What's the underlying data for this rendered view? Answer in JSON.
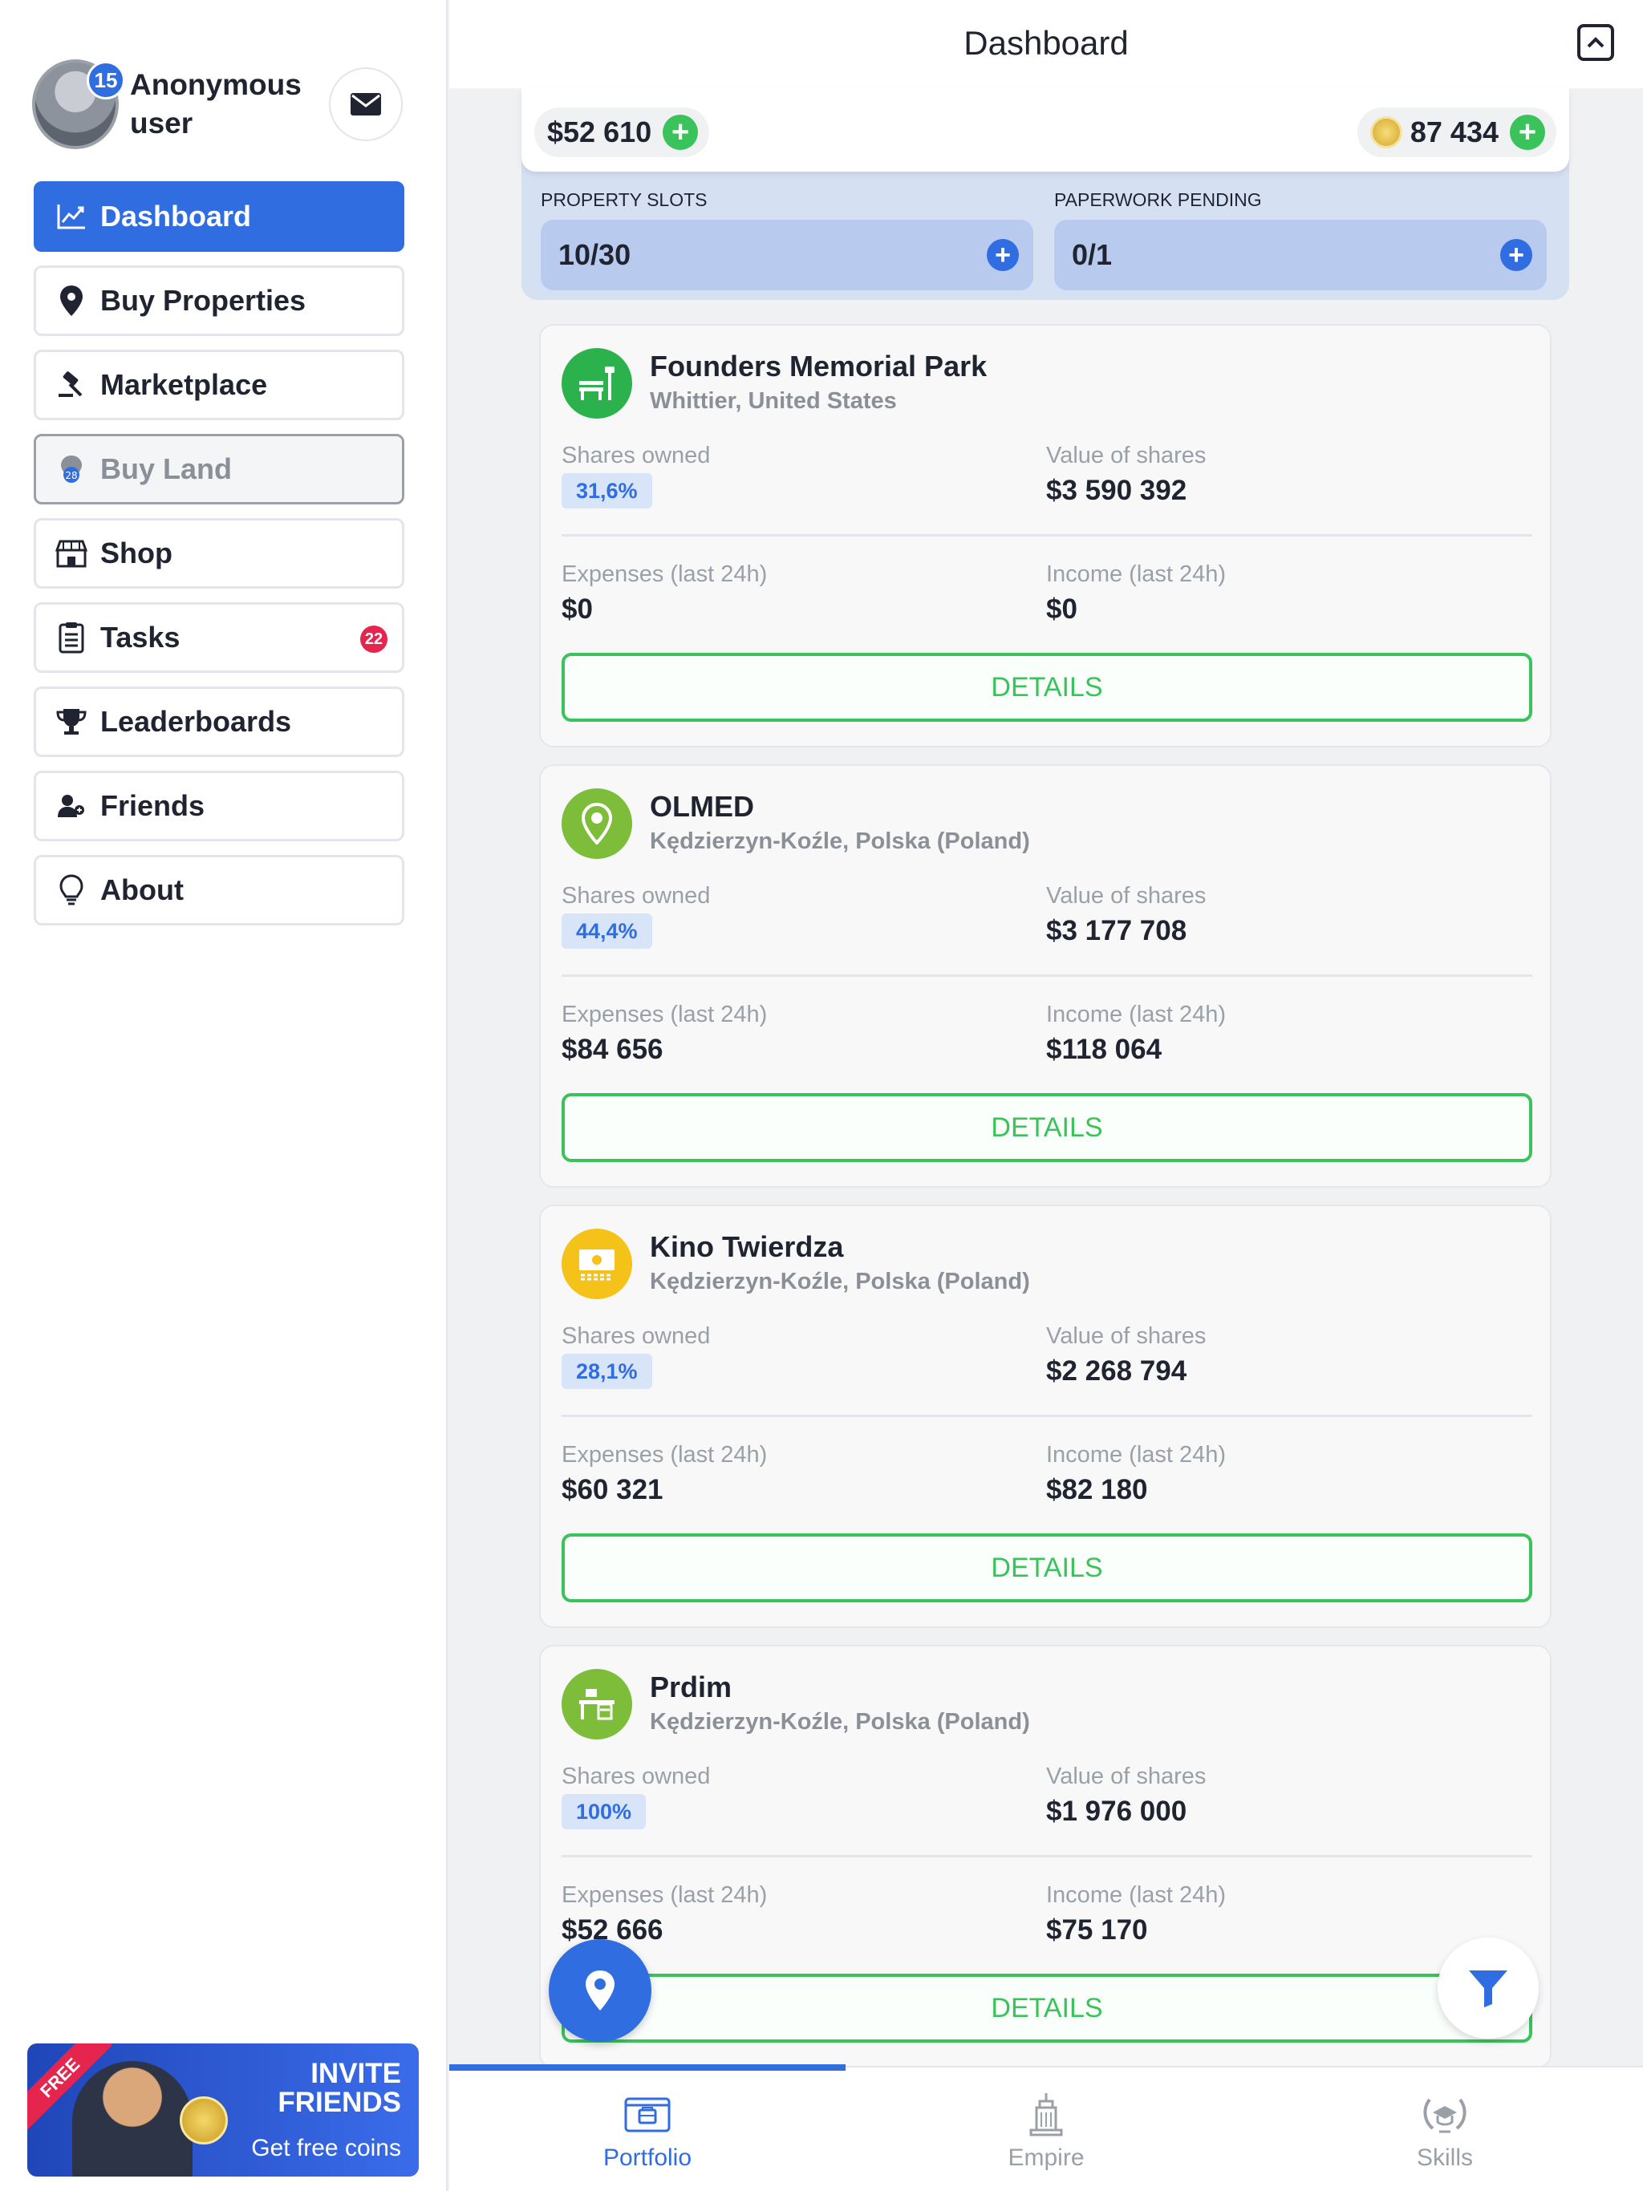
{
  "sidebar": {
    "profile": {
      "name": "Anonymous user",
      "level": "15"
    },
    "nav": [
      {
        "label": "Dashboard",
        "icon": "chart-line-icon",
        "state": "active"
      },
      {
        "label": "Buy Properties",
        "icon": "map-pin-icon",
        "state": "normal"
      },
      {
        "label": "Marketplace",
        "icon": "gavel-icon",
        "state": "normal"
      },
      {
        "label": "Buy Land",
        "icon": "land-icon",
        "state": "disabled"
      },
      {
        "label": "Shop",
        "icon": "shop-icon",
        "state": "normal"
      },
      {
        "label": "Tasks",
        "icon": "clipboard-icon",
        "state": "normal",
        "badge": "22"
      },
      {
        "label": "Leaderboards",
        "icon": "trophy-icon",
        "state": "normal"
      },
      {
        "label": "Friends",
        "icon": "friends-icon",
        "state": "normal"
      },
      {
        "label": "About",
        "icon": "lightbulb-icon",
        "state": "normal"
      }
    ],
    "invite": {
      "ribbon": "FREE",
      "title": "INVITE FRIENDS",
      "subtitle": "Get free coins"
    }
  },
  "header": {
    "title": "Dashboard"
  },
  "balance": {
    "cash": "$52 610",
    "coins": "87 434",
    "property_slots_label": "PROPERTY SLOTS",
    "property_slots_value": "10/30",
    "paperwork_label": "PAPERWORK PENDING",
    "paperwork_value": "0/1"
  },
  "labels": {
    "shares_owned": "Shares owned",
    "value_of_shares": "Value of shares",
    "expenses": "Expenses (last 24h)",
    "income": "Income (last 24h)",
    "details": "DETAILS"
  },
  "properties": [
    {
      "name": "Founders Memorial Park",
      "location": "Whittier, United States",
      "shares": "31,6%",
      "value": "$3 590 392",
      "expenses": "$0",
      "income": "$0",
      "color": "#2bb24c",
      "icon": "park-bench-icon"
    },
    {
      "name": "OLMED",
      "location": "Kędzierzyn-Koźle, Polska (Poland)",
      "shares": "44,4%",
      "value": "$3 177 708",
      "expenses": "$84 656",
      "income": "$118 064",
      "color": "#7dbd3a",
      "icon": "location-pin-icon"
    },
    {
      "name": "Kino Twierdza",
      "location": "Kędzierzyn-Koźle, Polska (Poland)",
      "shares": "28,1%",
      "value": "$2 268 794",
      "expenses": "$60 321",
      "income": "$82 180",
      "color": "#f5c21a",
      "icon": "cinema-icon"
    },
    {
      "name": "Prdim",
      "location": "Kędzierzyn-Koźle, Polska (Poland)",
      "shares": "100%",
      "value": "$1 976 000",
      "expenses": "$52 666",
      "income": "$75 170",
      "color": "#7dbd3a",
      "icon": "office-desk-icon"
    }
  ],
  "tabs": [
    {
      "label": "Portfolio",
      "icon": "portfolio-icon",
      "active": true
    },
    {
      "label": "Empire",
      "icon": "empire-building-icon",
      "active": false
    },
    {
      "label": "Skills",
      "icon": "skills-wreath-icon",
      "active": false
    }
  ],
  "colors": {
    "accent": "#2f6de0",
    "success": "#3ac35a",
    "badge": "#e6254e"
  }
}
